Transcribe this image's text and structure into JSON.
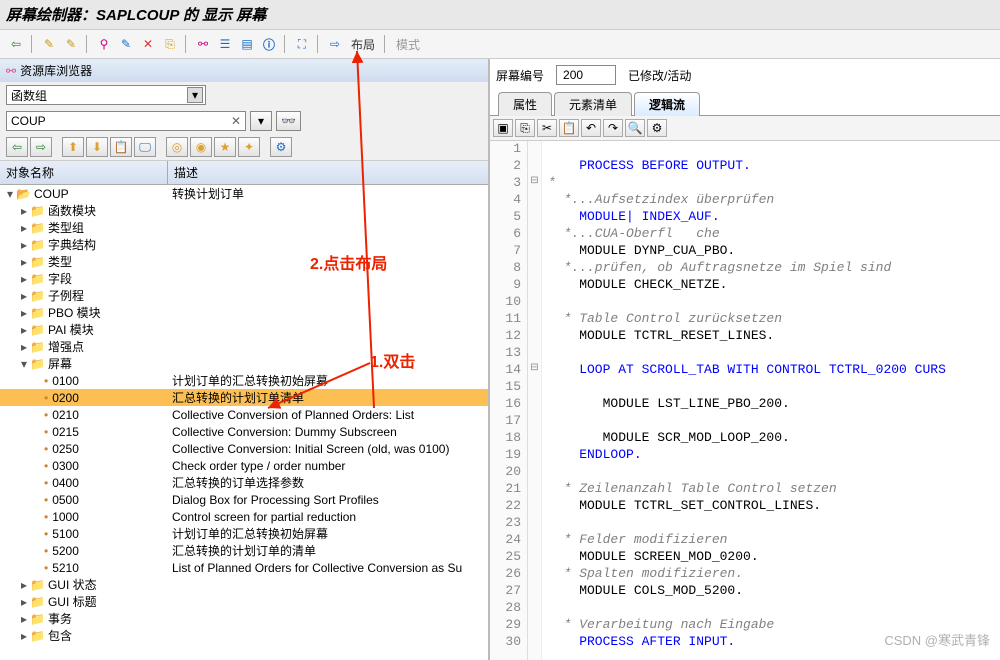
{
  "title": "屏幕绘制器：SAPLCOUP 的 显示 屏幕",
  "toolbar": {
    "layout_label": "布局",
    "mode_label": "模式"
  },
  "navigator": {
    "title": "资源库浏览器",
    "dropdown_value": "函数组",
    "search_value": "COUP"
  },
  "tree": {
    "col_name": "对象名称",
    "col_desc": "描述",
    "root": "COUP",
    "root_desc": "转换计划订单",
    "folders": [
      "函数模块",
      "类型组",
      "字典结构",
      "类型",
      "字段",
      "子例程",
      "PBO 模块",
      "PAI 模块",
      "增强点",
      "屏幕"
    ],
    "screens": [
      {
        "num": "0100",
        "desc": "计划订单的汇总转换初始屏幕"
      },
      {
        "num": "0200",
        "desc": "汇总转换的计划订单清单",
        "hl": true
      },
      {
        "num": "0210",
        "desc": "Collective Conversion of Planned Orders: List"
      },
      {
        "num": "0215",
        "desc": "Collective Conversion: Dummy Subscreen"
      },
      {
        "num": "0250",
        "desc": "Collective Conversion: Initial Screen (old, was 0100)"
      },
      {
        "num": "0300",
        "desc": "Check order  type / order number"
      },
      {
        "num": "0400",
        "desc": "汇总转换的订单选择参数"
      },
      {
        "num": "0500",
        "desc": "Dialog Box for Processing Sort Profiles"
      },
      {
        "num": "1000",
        "desc": "Control screen for partial reduction"
      },
      {
        "num": "5100",
        "desc": "计划订单的汇总转换初始屏幕"
      },
      {
        "num": "5200",
        "desc": "汇总转换的计划订单的清单"
      },
      {
        "num": "5210",
        "desc": "List of Planned Orders for Collective Conversion as Su"
      }
    ],
    "folders_after": [
      "GUI 状态",
      "GUI 标题",
      "事务",
      "包含"
    ]
  },
  "right": {
    "screen_no_label": "屏幕编号",
    "screen_no": "200",
    "status": "已修改/活动",
    "tabs": [
      "属性",
      "元素清单",
      "逻辑流"
    ]
  },
  "annotations": {
    "a1": "1.双击",
    "a2": "2.点击布局"
  },
  "watermark": "CSDN @寒武青锋",
  "code": {
    "lines": [
      {
        "n": 1,
        "f": "",
        "raw": ""
      },
      {
        "n": 2,
        "f": "",
        "raw": "    PROCESS BEFORE OUTPUT.",
        "cls": "kw-blue"
      },
      {
        "n": 3,
        "f": "⊟",
        "raw": "*",
        "cls": "kw-gray"
      },
      {
        "n": 4,
        "f": "",
        "raw": "  *...Aufsetzindex überprüfen",
        "cls": "kw-gray"
      },
      {
        "n": 5,
        "f": "",
        "raw": "    MODULE| INDEX_AUF.",
        "cls": "kw-blue"
      },
      {
        "n": 6,
        "f": "",
        "raw": "  *...CUA-Oberfl   che",
        "cls": "kw-gray"
      },
      {
        "n": 7,
        "f": "",
        "raw": "    MODULE DYNP_CUA_PBO.",
        "cls": "kw-black"
      },
      {
        "n": 8,
        "f": "",
        "raw": "  *...prüfen, ob Auftragsnetze im Spiel sind",
        "cls": "kw-gray"
      },
      {
        "n": 9,
        "f": "",
        "raw": "    MODULE CHECK_NETZE.",
        "cls": "kw-black"
      },
      {
        "n": 10,
        "f": "",
        "raw": ""
      },
      {
        "n": 11,
        "f": "",
        "raw": "  * Table Control zurücksetzen",
        "cls": "kw-gray"
      },
      {
        "n": 12,
        "f": "",
        "raw": "    MODULE TCTRL_RESET_LINES.",
        "cls": "kw-black"
      },
      {
        "n": 13,
        "f": "",
        "raw": ""
      },
      {
        "n": 14,
        "f": "⊟",
        "raw": "    LOOP AT SCROLL_TAB WITH CONTROL TCTRL_0200 CURS",
        "cls": "kw-blue"
      },
      {
        "n": 15,
        "f": "",
        "raw": ""
      },
      {
        "n": 16,
        "f": "",
        "raw": "       MODULE LST_LINE_PBO_200.",
        "cls": "kw-black"
      },
      {
        "n": 17,
        "f": "",
        "raw": ""
      },
      {
        "n": 18,
        "f": "",
        "raw": "       MODULE SCR_MOD_LOOP_200.",
        "cls": "kw-black"
      },
      {
        "n": 19,
        "f": "",
        "raw": "    ENDLOOP.",
        "cls": "kw-blue"
      },
      {
        "n": 20,
        "f": "",
        "raw": ""
      },
      {
        "n": 21,
        "f": "",
        "raw": "  * Zeilenanzahl Table Control setzen",
        "cls": "kw-gray"
      },
      {
        "n": 22,
        "f": "",
        "raw": "    MODULE TCTRL_SET_CONTROL_LINES.",
        "cls": "kw-black"
      },
      {
        "n": 23,
        "f": "",
        "raw": ""
      },
      {
        "n": 24,
        "f": "",
        "raw": "  * Felder modifizieren",
        "cls": "kw-gray"
      },
      {
        "n": 25,
        "f": "",
        "raw": "    MODULE SCREEN_MOD_0200.",
        "cls": "kw-black"
      },
      {
        "n": 26,
        "f": "",
        "raw": "  * Spalten modifizieren.",
        "cls": "kw-gray"
      },
      {
        "n": 27,
        "f": "",
        "raw": "    MODULE COLS_MOD_5200.",
        "cls": "kw-black"
      },
      {
        "n": 28,
        "f": "",
        "raw": ""
      },
      {
        "n": 29,
        "f": "",
        "raw": "  * Verarbeitung nach Eingabe",
        "cls": "kw-gray"
      },
      {
        "n": 30,
        "f": "",
        "raw": "    PROCESS AFTER INPUT.",
        "cls": "kw-blue"
      }
    ]
  }
}
